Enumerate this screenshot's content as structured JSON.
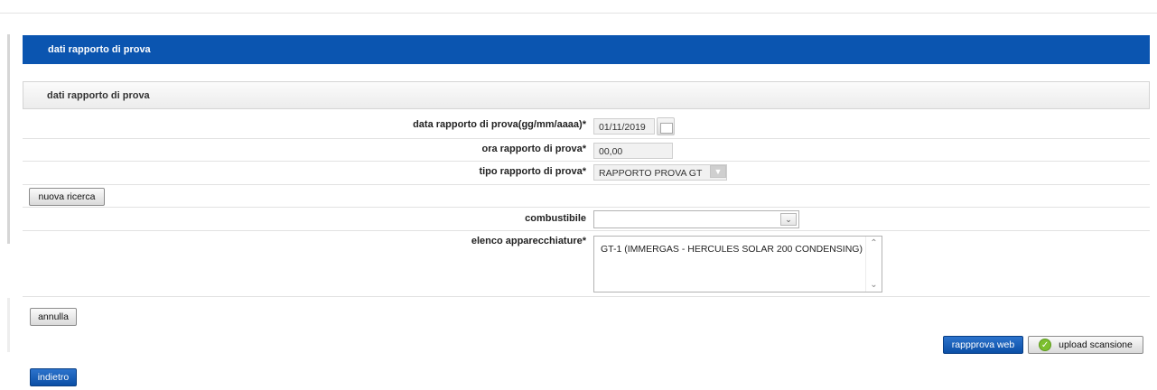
{
  "header": {
    "title": "dati rapporto di prova"
  },
  "section": {
    "title": "dati rapporto di prova"
  },
  "form": {
    "date": {
      "label": "data rapporto di prova(gg/mm/aaaa)*",
      "value": "01/11/2019"
    },
    "time": {
      "label": "ora rapporto di prova*",
      "value": "00,00"
    },
    "type": {
      "label": "tipo rapporto di prova*",
      "value": "RAPPORTO PROVA GT"
    },
    "fuel": {
      "label": "combustibile",
      "value": ""
    },
    "equipment": {
      "label": "elenco apparecchiature*",
      "items": [
        "GT-1 (IMMERGAS - HERCULES SOLAR 200 CONDENSING)"
      ]
    }
  },
  "buttons": {
    "new_search": "nuova ricerca",
    "cancel": "annulla",
    "web_report": "rappprova web",
    "upload_scan": "upload scansione",
    "back": "indietro"
  },
  "colors": {
    "header_bg": "#0b55b0",
    "primary_button": "#0b4fa6",
    "upload_check": "#7cbf2f"
  }
}
